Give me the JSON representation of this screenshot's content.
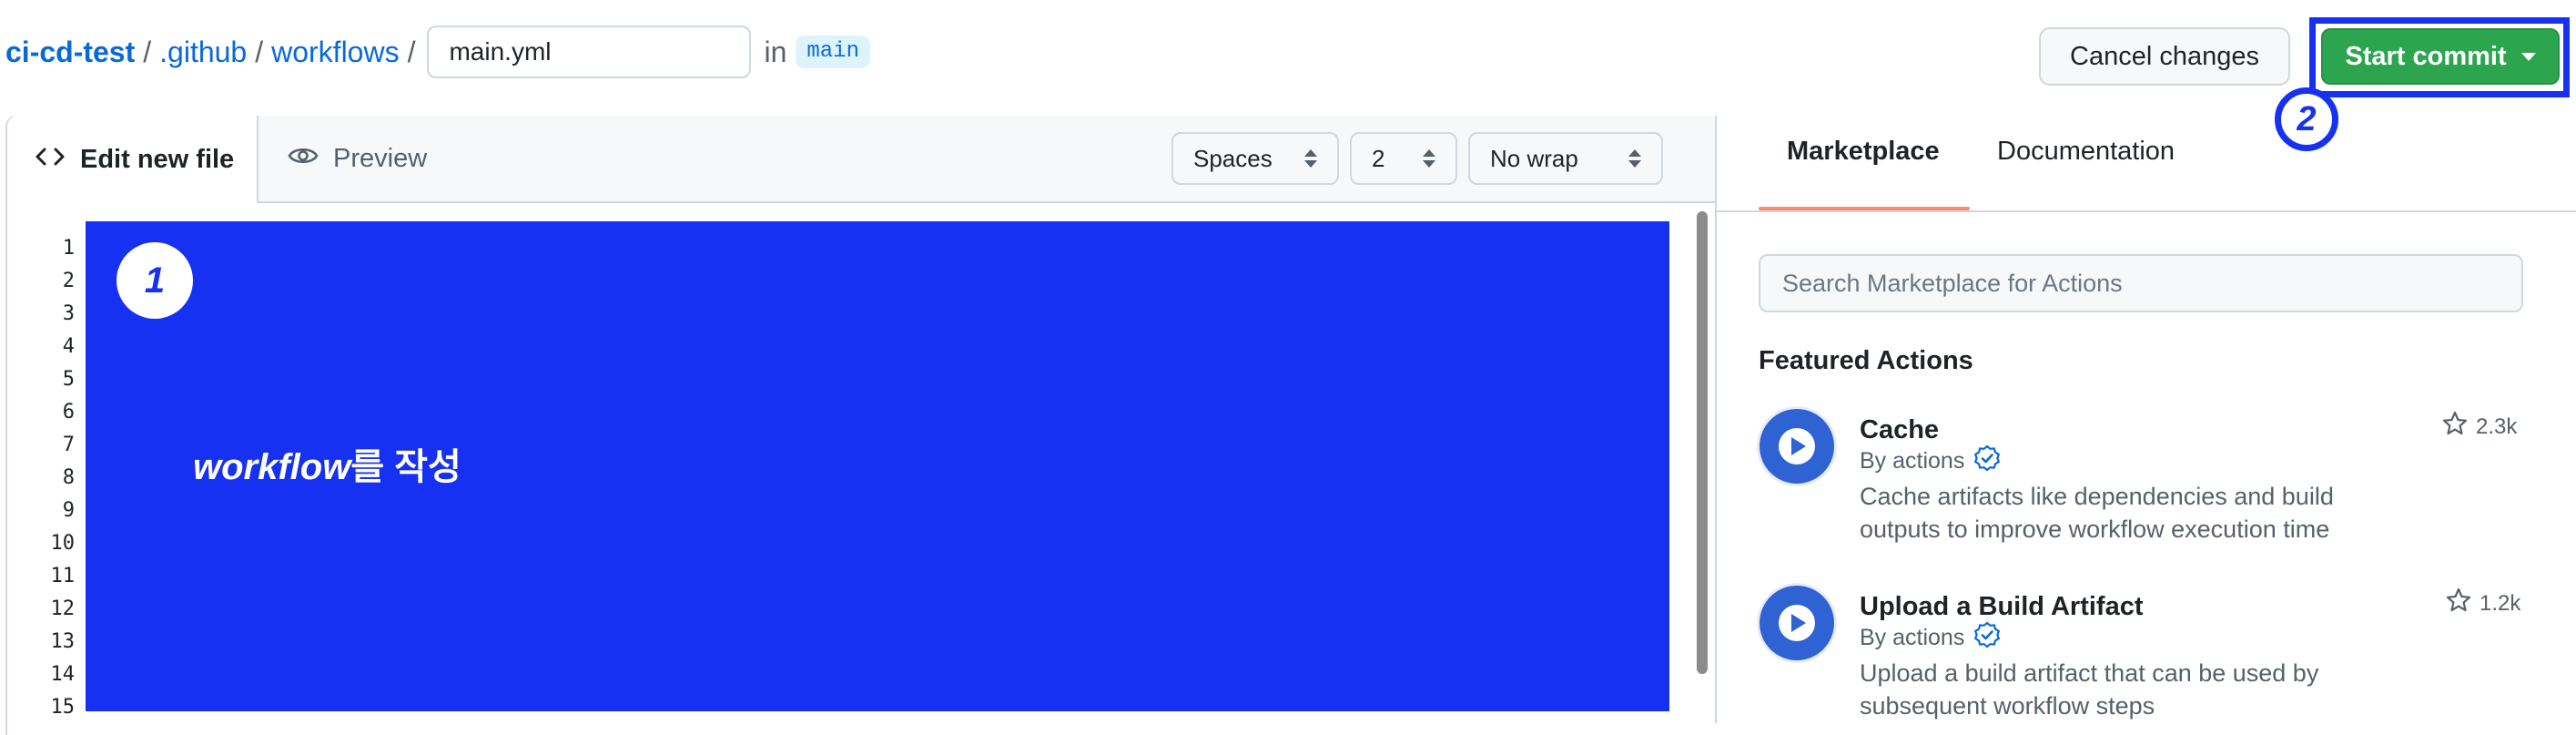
{
  "breadcrumb": {
    "repo": "ci-cd-test",
    "folder1": ".github",
    "folder2": "workflows",
    "separator": "/",
    "filename": "main.yml",
    "in_label": "in",
    "branch": "main"
  },
  "header_actions": {
    "cancel_label": "Cancel changes",
    "commit_label": "Start commit"
  },
  "annotations": {
    "marker1": "1",
    "marker2": "2",
    "overlay_italic": "workflow",
    "overlay_rest": "를 작성",
    "highlight_color": "#1631f2"
  },
  "editor": {
    "tab_edit": "Edit new file",
    "tab_preview": "Preview",
    "indent_mode": "Spaces",
    "indent_size": "2",
    "wrap_mode": "No wrap",
    "line_numbers": [
      "1",
      "2",
      "3",
      "4",
      "5",
      "6",
      "7",
      "8",
      "9",
      "10",
      "11",
      "12",
      "13",
      "14",
      "15"
    ]
  },
  "sidebar": {
    "tab_marketplace": "Marketplace",
    "tab_documentation": "Documentation",
    "search_placeholder": "Search Marketplace for Actions",
    "featured_heading": "Featured Actions",
    "actions": [
      {
        "title": "Cache",
        "by": "By actions",
        "description_line1": "Cache artifacts like dependencies and build",
        "description_line2": "outputs to improve workflow execution time",
        "stars": "2.3k"
      },
      {
        "title": "Upload a Build Artifact",
        "by": "By actions",
        "description_line1": "Upload a build artifact that can be used by",
        "description_line2": "subsequent workflow steps",
        "stars": "1.2k"
      }
    ]
  },
  "colors": {
    "primary_green": "#2da44e",
    "link_blue": "#0969da",
    "annotation_blue": "#1631f2",
    "tab_underline": "#fd8c73"
  }
}
